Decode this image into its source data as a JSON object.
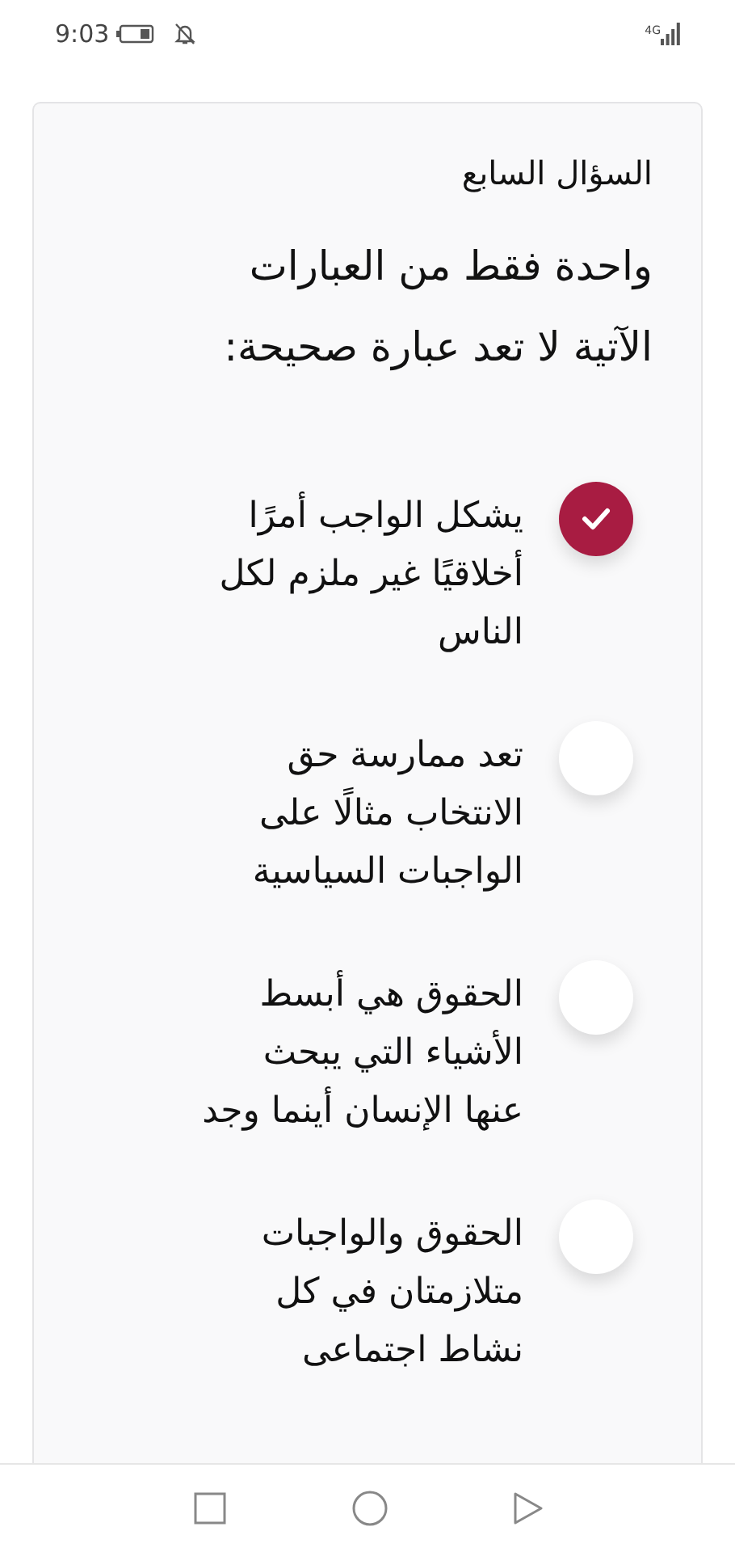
{
  "status_bar": {
    "time": "9:03",
    "network": "4G"
  },
  "question": {
    "title": "السؤال السابع",
    "text": "واحدة فقط من العبارات الآتية لا تعد عبارة صحيحة:"
  },
  "options": [
    {
      "label": "يشكل الواجب أمرًا أخلاقيًا غير ملزم لكل الناس",
      "selected": true
    },
    {
      "label": "تعد ممارسة حق الانتخاب مثالًا على الواجبات السياسية",
      "selected": false
    },
    {
      "label": "الحقوق هي أبسط الأشياء التي يبحث عنها الإنسان أينما وجد",
      "selected": false
    },
    {
      "label": "الحقوق والواجبات متلازمتان في كل نشاط اجتماعى",
      "selected": false
    }
  ]
}
